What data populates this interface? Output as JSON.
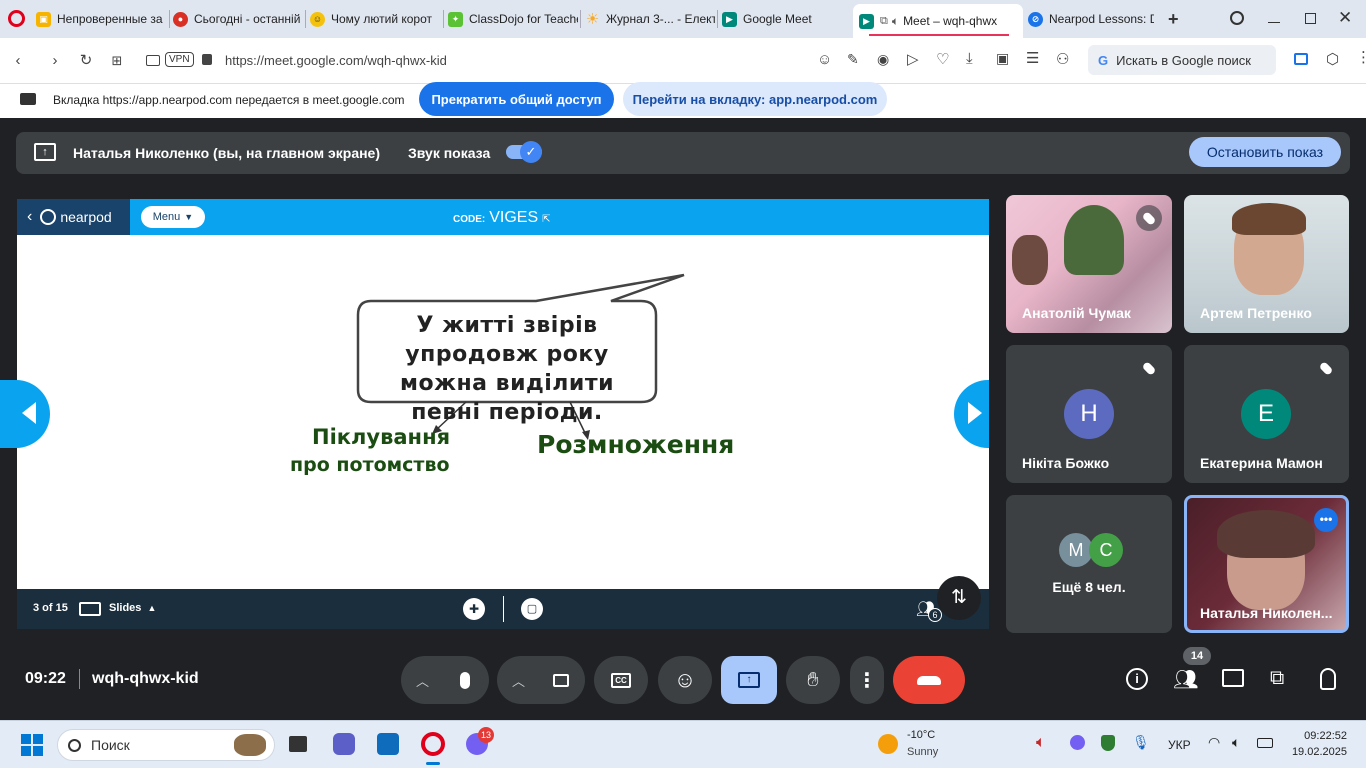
{
  "browser": {
    "tabs": [
      {
        "title": "Непроверенные за",
        "favicon": "classroom-icon",
        "color": "#f6b400"
      },
      {
        "title": "Сьогодні - останній",
        "favicon": "news-icon",
        "color": "#d93025"
      },
      {
        "title": "Чому лютий корот",
        "favicon": "smiley-icon",
        "color": "#f4c20d"
      },
      {
        "title": "ClassDojo for Teache",
        "favicon": "classdojo-icon",
        "color": "#5bc236"
      },
      {
        "title": "Журнал 3-... - Елект",
        "favicon": "sun-icon",
        "color": "#f9a825"
      },
      {
        "title": "Google Meet",
        "favicon": "meet-icon",
        "color": "#00897b"
      },
      {
        "title": "Meet – wqh-qhwx",
        "favicon": "meet-icon",
        "color": "#00897b"
      },
      {
        "title": "Nearpod Lessons: D",
        "favicon": "nearpod-icon",
        "color": "#1a73e8"
      }
    ],
    "new_tab": "+",
    "vpn": "VPN",
    "url": "https://meet.google.com/wqh-qhwx-kid",
    "search_placeholder": "Искать в Google поиск"
  },
  "share_bar": {
    "message": "Вкладка https://app.nearpod.com передается в meet.google.com",
    "stop_button": "Прекратить общий доступ",
    "goto_button": "Перейти на вкладку: app.nearpod.com"
  },
  "presenting": {
    "label": "Наталья Николенко (вы, на главном экране)",
    "audio_label": "Звук показа",
    "audio_on": true,
    "stop_button": "Остановить показ"
  },
  "nearpod": {
    "logo": "nearpod",
    "menu": "Menu",
    "code_label": "CODE:",
    "code": "VIGES",
    "slide_text": "У житті звірів упродовж року можна виділити певні періоди.",
    "branch_left_1": "Піклування",
    "branch_left_2": "про потомство",
    "branch_right": "Розмноження",
    "page": "3 of 15",
    "slides_label": "Slides",
    "participants": "6"
  },
  "participants": [
    {
      "name": "Анатолій Чумак",
      "muted": true,
      "type": "video"
    },
    {
      "name": "Артем Петренко",
      "muted": false,
      "type": "video"
    },
    {
      "name": "Нікіта Божко",
      "muted": true,
      "initial": "Н",
      "color": "#5c6bc0"
    },
    {
      "name": "Екатерина Мамон",
      "muted": true,
      "initial": "Е",
      "color": "#00897b"
    },
    {
      "name": "Ещё 8 чел.",
      "initials": [
        "М",
        "С"
      ],
      "colors": [
        "#78909c",
        "#43a047"
      ]
    },
    {
      "name": "Наталья Николен...",
      "self": true,
      "type": "video"
    }
  ],
  "meeting": {
    "time": "09:22",
    "code": "wqh-qhwx-kid",
    "people_count": "14"
  },
  "taskbar": {
    "search": "Поиск",
    "weather_temp": "-10°C",
    "weather_text": "Sunny",
    "badge": "13",
    "lang": "УКР",
    "clock_time": "09:22:52",
    "clock_date": "19.02.2025"
  }
}
